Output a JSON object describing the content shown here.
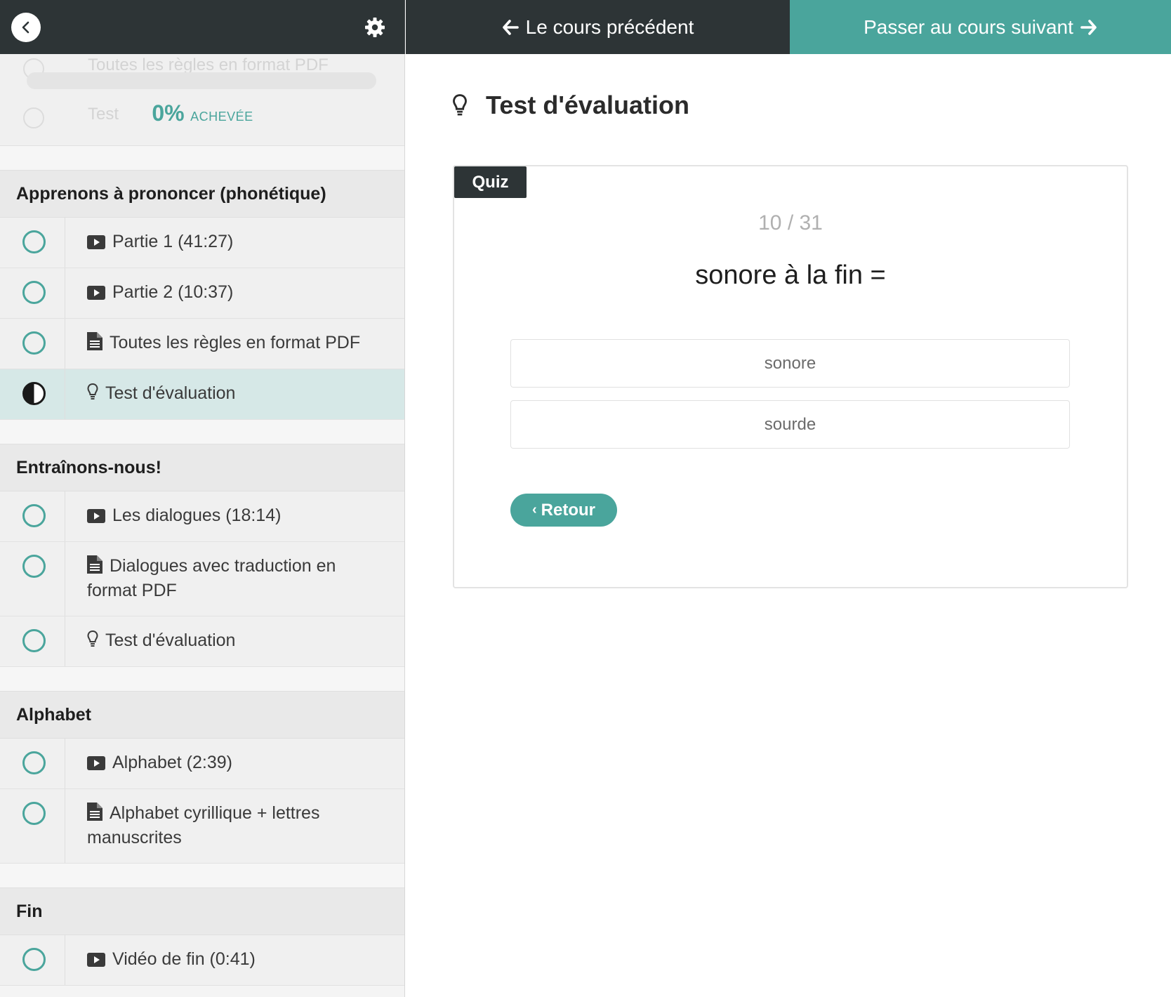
{
  "topbar": {
    "back_icon": "chevron-left-icon",
    "settings_icon": "gear-icon",
    "prev_label": "Le cours précédent",
    "next_label": "Passer au cours suivant",
    "accent_color": "#4aa59c",
    "dark_color": "#2d3436"
  },
  "progress": {
    "ghost_row_1": "Toutes les règles en format PDF",
    "ghost_row_2": "Test",
    "percent_label": "0%",
    "word": "ACHEVÉE",
    "value": 0
  },
  "sections": [
    {
      "title": "Apprenons à prononcer (phonétique)",
      "lessons": [
        {
          "label": "Partie 1 (41:27)",
          "icon": "video-play-icon",
          "status": "not-started"
        },
        {
          "label": "Partie 2 (10:37)",
          "icon": "video-play-icon",
          "status": "not-started"
        },
        {
          "label": "Toutes les règles en format PDF",
          "icon": "document-icon",
          "status": "not-started"
        },
        {
          "label": "Test d'évaluation",
          "icon": "lightbulb-icon",
          "status": "in-progress",
          "active": true
        }
      ]
    },
    {
      "title": "Entraînons-nous!",
      "lessons": [
        {
          "label": "Les dialogues (18:14)",
          "icon": "video-play-icon",
          "status": "not-started"
        },
        {
          "label": "Dialogues avec traduction en format PDF",
          "icon": "document-icon",
          "status": "not-started"
        },
        {
          "label": "Test d'évaluation",
          "icon": "lightbulb-icon",
          "status": "not-started"
        }
      ]
    },
    {
      "title": "Alphabet",
      "lessons": [
        {
          "label": "Alphabet (2:39)",
          "icon": "video-play-icon",
          "status": "not-started"
        },
        {
          "label": "Alphabet cyrillique + lettres manuscrites",
          "icon": "document-icon",
          "status": "not-started"
        }
      ]
    },
    {
      "title": "Fin",
      "lessons": [
        {
          "label": "Vidéo de fin (0:41)",
          "icon": "video-play-icon",
          "status": "not-started"
        }
      ]
    }
  ],
  "main": {
    "title_icon": "lightbulb-icon",
    "title": "Test d'évaluation",
    "quiz": {
      "badge": "Quiz",
      "counter": "10 / 31",
      "question": "sonore à la fin =",
      "answers": [
        "sonore",
        "sourde"
      ],
      "back_label": "Retour"
    }
  }
}
